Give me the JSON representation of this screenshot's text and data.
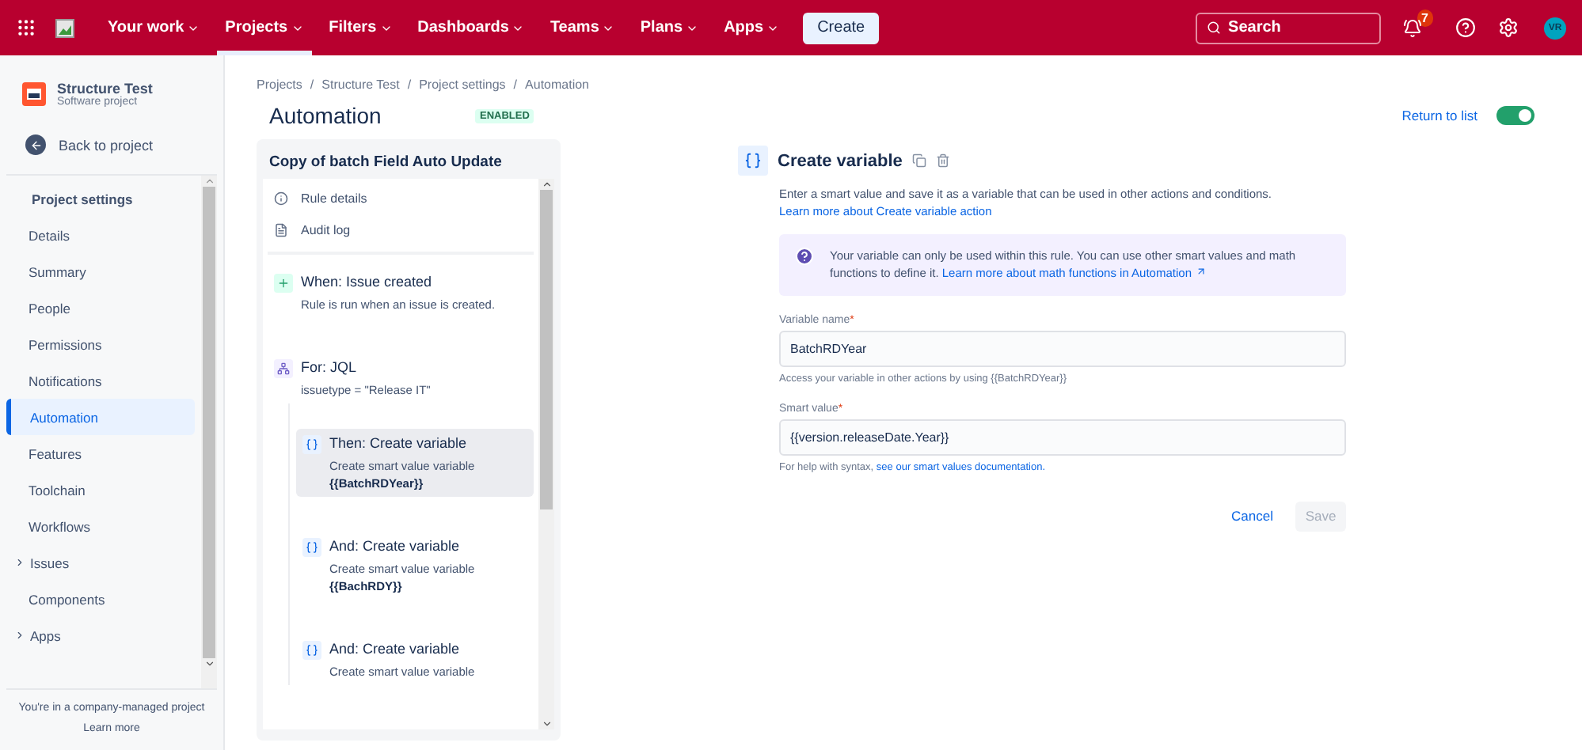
{
  "topbar": {
    "nav": [
      {
        "label": "Your work",
        "selected": false
      },
      {
        "label": "Projects",
        "selected": true
      },
      {
        "label": "Filters",
        "selected": false
      },
      {
        "label": "Dashboards",
        "selected": false
      },
      {
        "label": "Teams",
        "selected": false
      },
      {
        "label": "Plans",
        "selected": false
      },
      {
        "label": "Apps",
        "selected": false
      }
    ],
    "create": "Create",
    "search": {
      "placeholder": "Search"
    },
    "notifications": "7",
    "avatar": "VR"
  },
  "sidebar": {
    "project": {
      "name": "Structure Test",
      "type": "Software project"
    },
    "back": "Back to project",
    "section_title": "Project settings",
    "items": [
      {
        "label": "Details",
        "kind": "link",
        "selected": false
      },
      {
        "label": "Summary",
        "kind": "link",
        "selected": false
      },
      {
        "label": "People",
        "kind": "link",
        "selected": false
      },
      {
        "label": "Permissions",
        "kind": "link",
        "selected": false
      },
      {
        "label": "Notifications",
        "kind": "link",
        "selected": false
      },
      {
        "label": "Automation",
        "kind": "link",
        "selected": true
      },
      {
        "label": "Features",
        "kind": "link",
        "selected": false
      },
      {
        "label": "Toolchain",
        "kind": "link",
        "selected": false
      },
      {
        "label": "Workflows",
        "kind": "link",
        "selected": false
      },
      {
        "label": "Issues",
        "kind": "group",
        "selected": false
      },
      {
        "label": "Components",
        "kind": "link",
        "selected": false
      },
      {
        "label": "Apps",
        "kind": "group",
        "selected": false
      }
    ],
    "footer": {
      "text": "You're in a company-managed project",
      "link": "Learn more"
    }
  },
  "breadcrumbs": {
    "separator": "/",
    "items": [
      "Projects",
      "Structure Test",
      "Project settings",
      "Automation"
    ]
  },
  "page_title": "Automation",
  "status": "ENABLED",
  "return_link": "Return to list",
  "rule_enabled": {
    "on": true
  },
  "rule": {
    "title": "Copy of batch Field Auto Update",
    "menu": [
      {
        "label": "Rule details",
        "kind": "info"
      },
      {
        "label": "Audit log",
        "kind": "log"
      }
    ],
    "steps": [
      {
        "kind": "trigger",
        "title": "When: Issue created",
        "description": "Rule is run when an issue is created.",
        "selected": false
      },
      {
        "kind": "branch",
        "title": "For: JQL",
        "description": "issuetype = \"Release IT\"",
        "selected": false,
        "children": [
          {
            "kind": "action",
            "title": "Then: Create variable",
            "description": "Create smart value variable",
            "variable": "{{BatchRDYear}}",
            "selected": true
          },
          {
            "kind": "action",
            "title": "And: Create variable",
            "description": "Create smart value variable",
            "variable": "{{BachRDY}}",
            "selected": false
          },
          {
            "kind": "action",
            "title": "And: Create variable",
            "description": "Create smart value variable",
            "selected": false
          }
        ]
      }
    ]
  },
  "editor": {
    "title": "Create variable",
    "description": "Enter a smart value and save it as a variable that can be used in other actions and conditions.",
    "description_link": "Learn more about Create variable action",
    "info": {
      "text": "Your variable can only be used within this rule. You can use other smart values and math functions to define it.",
      "link": "Learn more about math functions in Automation"
    },
    "fields": [
      {
        "label": "Variable name",
        "required_mark": "*",
        "value": "BatchRDYear",
        "help": "Access your variable in other actions by using {{BatchRDYear}}"
      },
      {
        "label": "Smart value",
        "required_mark": "*",
        "value": "{{version.releaseDate.Year}}",
        "help": "For help with syntax,",
        "help_link": "see our smart values documentation."
      }
    ],
    "cancel": "Cancel",
    "save": {
      "label": "Save",
      "disabled": true
    }
  }
}
